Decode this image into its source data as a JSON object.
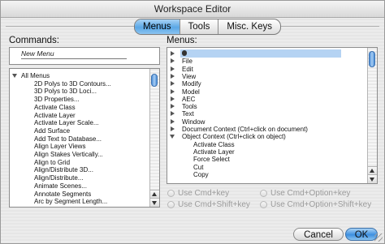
{
  "window": {
    "title": "Workspace Editor"
  },
  "tabs": [
    {
      "label": "Menus",
      "active": true
    },
    {
      "label": "Tools",
      "active": false
    },
    {
      "label": "Misc. Keys",
      "active": false
    }
  ],
  "commands": {
    "label": "Commands:",
    "new_item": "New Menu",
    "items": [
      {
        "label": "All Menus",
        "indent": 0,
        "expanded": true
      },
      {
        "label": "2D Polys to 3D Contours...",
        "indent": 1
      },
      {
        "label": "3D Polys to 3D Loci...",
        "indent": 1
      },
      {
        "label": "3D Properties...",
        "indent": 1
      },
      {
        "label": "Activate Class",
        "indent": 1
      },
      {
        "label": "Activate Layer",
        "indent": 1
      },
      {
        "label": "Activate Layer Scale...",
        "indent": 1
      },
      {
        "label": "Add Surface",
        "indent": 1
      },
      {
        "label": "Add Text to Database...",
        "indent": 1
      },
      {
        "label": "Align Layer Views",
        "indent": 1
      },
      {
        "label": "Align Stakes Vertically...",
        "indent": 1
      },
      {
        "label": "Align to Grid",
        "indent": 1
      },
      {
        "label": "Align/Distribute 3D...",
        "indent": 1
      },
      {
        "label": "Align/Distribute...",
        "indent": 1
      },
      {
        "label": "Animate Scenes...",
        "indent": 1
      },
      {
        "label": "Annotate Segments",
        "indent": 1
      },
      {
        "label": "Arc by Segment Length...",
        "indent": 1
      }
    ]
  },
  "menus": {
    "label": "Menus:",
    "items": [
      {
        "label": "",
        "kind": "apple",
        "expander": "right"
      },
      {
        "label": "File",
        "expander": "right"
      },
      {
        "label": "Edit",
        "expander": "right"
      },
      {
        "label": "View",
        "expander": "right"
      },
      {
        "label": "Modify",
        "expander": "right"
      },
      {
        "label": "Model",
        "expander": "right"
      },
      {
        "label": "AEC",
        "expander": "right"
      },
      {
        "label": "Tools",
        "expander": "right"
      },
      {
        "label": "Text",
        "expander": "right"
      },
      {
        "label": "Window",
        "expander": "right"
      },
      {
        "label": "Document Context (Ctrl+click on document)",
        "expander": "right"
      },
      {
        "label": "Object Context (Ctrl+click on object)",
        "expander": "down"
      },
      {
        "label": "Activate Class",
        "expander": "none",
        "indent": 1
      },
      {
        "label": "Activate Layer",
        "expander": "none",
        "indent": 1
      },
      {
        "label": "Force Select",
        "expander": "none",
        "indent": 1
      },
      {
        "label": "Cut",
        "expander": "none",
        "indent": 1
      },
      {
        "label": "Copy",
        "expander": "none",
        "indent": 1
      }
    ]
  },
  "shortcuts": {
    "cmd": "Use Cmd+key",
    "cmd_option": "Use Cmd+Option+key",
    "cmd_shift": "Use Cmd+Shift+key",
    "cmd_option_shift": "Use Cmd+Option+Shift+key"
  },
  "buttons": {
    "cancel": "Cancel",
    "ok": "OK"
  },
  "colors": {
    "accent": "#5aa7e6",
    "selection": "#b5d3f3"
  },
  "icons": {
    "apple": "apple-logo-icon"
  }
}
